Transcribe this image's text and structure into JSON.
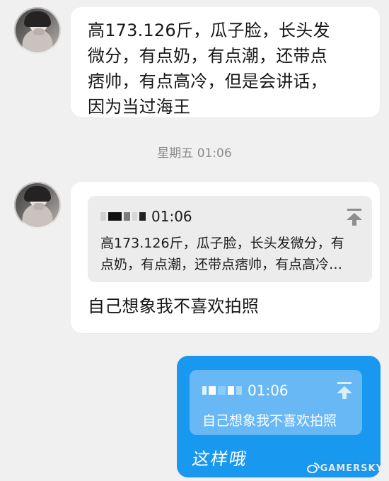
{
  "chat": {
    "messages": [
      {
        "text": "高173.126斤，瓜子脸，长头发\n微分，有点奶，有点潮，还带点\n痞帅，有点高冷，但是会讲话，\n因为当过海王"
      },
      {
        "time_divider": "星期五 01:06"
      },
      {
        "quote": {
          "time": "01:06",
          "text": "高173.126斤，瓜子脸，长头发微分，有\n点奶，有点潮，还带点痞帅，有点高冷…"
        },
        "text": "自己想象我不喜欢拍照"
      },
      {
        "quote": {
          "time": "01:06",
          "text": "自己想象我不喜欢拍照"
        },
        "reply": "这样哦"
      }
    ]
  },
  "watermark": {
    "text": "GAMERSKY"
  },
  "icons": {
    "avatar": "avatar-photo",
    "jump": "jump-to-top-icon",
    "watermark": "weibo-icon"
  },
  "colors": {
    "background": "#f0f0f0",
    "incoming_bubble": "#ffffff",
    "incoming_quote": "#ececec",
    "outgoing_bubble": "#1998f0",
    "outgoing_quote": "#68b8f6",
    "divider_text": "#8b8b8b"
  }
}
